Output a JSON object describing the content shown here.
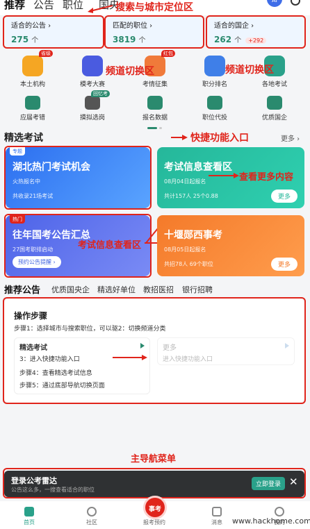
{
  "topnav": {
    "tabs": [
      "推荐",
      "公告",
      "职位",
      "国央"
    ],
    "avatar_text": "AI"
  },
  "annotations": {
    "search_city": "搜索与城市定位区",
    "channel_switch_1": "频道切换区",
    "channel_switch_2": "频道切换区",
    "quick_entry": "快捷功能入口",
    "view_more": "查看更多内容",
    "exam_info": "考试信息查看区",
    "main_nav": "主导航菜单"
  },
  "stats": [
    {
      "label": "适合的公告",
      "value": "275",
      "unit": "个",
      "badge": ""
    },
    {
      "label": "匹配的职位",
      "value": "3819",
      "unit": "个",
      "badge": ""
    },
    {
      "label": "适合的国企",
      "value": "262",
      "unit": "个",
      "badge": "+292"
    }
  ],
  "channels": [
    {
      "label": "本土机构",
      "tag": "省级",
      "color": "#f5a623",
      "icon": "institution-icon"
    },
    {
      "label": "模考大赛",
      "tag": "",
      "color": "#4a5be0",
      "icon": "trophy-icon"
    },
    {
      "label": "考情征集",
      "tag": "红包",
      "color": "#f07a3a",
      "icon": "survey-icon"
    },
    {
      "label": "职分排名",
      "tag": "",
      "color": "#3f7fe8",
      "icon": "ranking-icon"
    },
    {
      "label": "各地考试",
      "tag": "",
      "color": "#2aa18a",
      "icon": "map-icon"
    },
    {
      "label": "应届考错",
      "tag": "",
      "color": "#2a8a6e",
      "icon": "graduate-icon"
    },
    {
      "label": "摸拟选岗",
      "tag": "回忆考",
      "color": "#555",
      "icon": "select-icon"
    },
    {
      "label": "报名数据",
      "tag": "",
      "color": "#2a8a6e",
      "icon": "data-icon"
    },
    {
      "label": "职位代投",
      "tag": "",
      "color": "#2a8a6e",
      "icon": "delegate-icon"
    },
    {
      "label": "优质国企",
      "tag": "",
      "color": "#2a8a6e",
      "icon": "enterprise-icon"
    }
  ],
  "featured": {
    "title": "精选考试",
    "more": "更多 ›",
    "cards": [
      {
        "ribbon": "专题",
        "title": "湖北热门考试机会",
        "sub": "火热报名中",
        "foot": "共收录21场考试",
        "button": ""
      },
      {
        "ribbon": "",
        "title": "考试信息查看区",
        "sub": "08月04日起报名",
        "foot": "共计157人 25个0.88",
        "button": "更多"
      },
      {
        "ribbon": "热门",
        "title": "往年国考公告汇总",
        "sub": "27国考职排启动",
        "foot": "",
        "button": "预约公告提醒 ›"
      },
      {
        "ribbon": "",
        "title": "十堰郧西事考",
        "sub": "08月05日起报名",
        "foot": "共招78人 69个职位",
        "button": "更多"
      }
    ]
  },
  "recommend_tabs": [
    "推荐公告",
    "优质国央企",
    "精选好单位",
    "教招医招",
    "银行招聘"
  ],
  "steps": {
    "heading": "操作步骤",
    "line1": "步骤1：选择城市与搜索职位，可以驱2：切换频道分类",
    "col1_title": "精选考试",
    "col2_title": "更多",
    "line3a": "3：进入快捷功能入口",
    "line3b": "进入快捷功能入口",
    "line4": "步骤4：查看精选考试信息",
    "line5": "步骤5：通过底部导航切换页面"
  },
  "login": {
    "title": "登录公考雷达",
    "subtitle": "公告这么多，一搜查看适合的职位",
    "button": "立即登录",
    "close": "✕"
  },
  "tabbar": {
    "items": [
      "首页",
      "社区",
      "报考预约",
      "消息",
      "我的"
    ],
    "fab": "事考"
  },
  "watermark": "www.hackhome.com"
}
